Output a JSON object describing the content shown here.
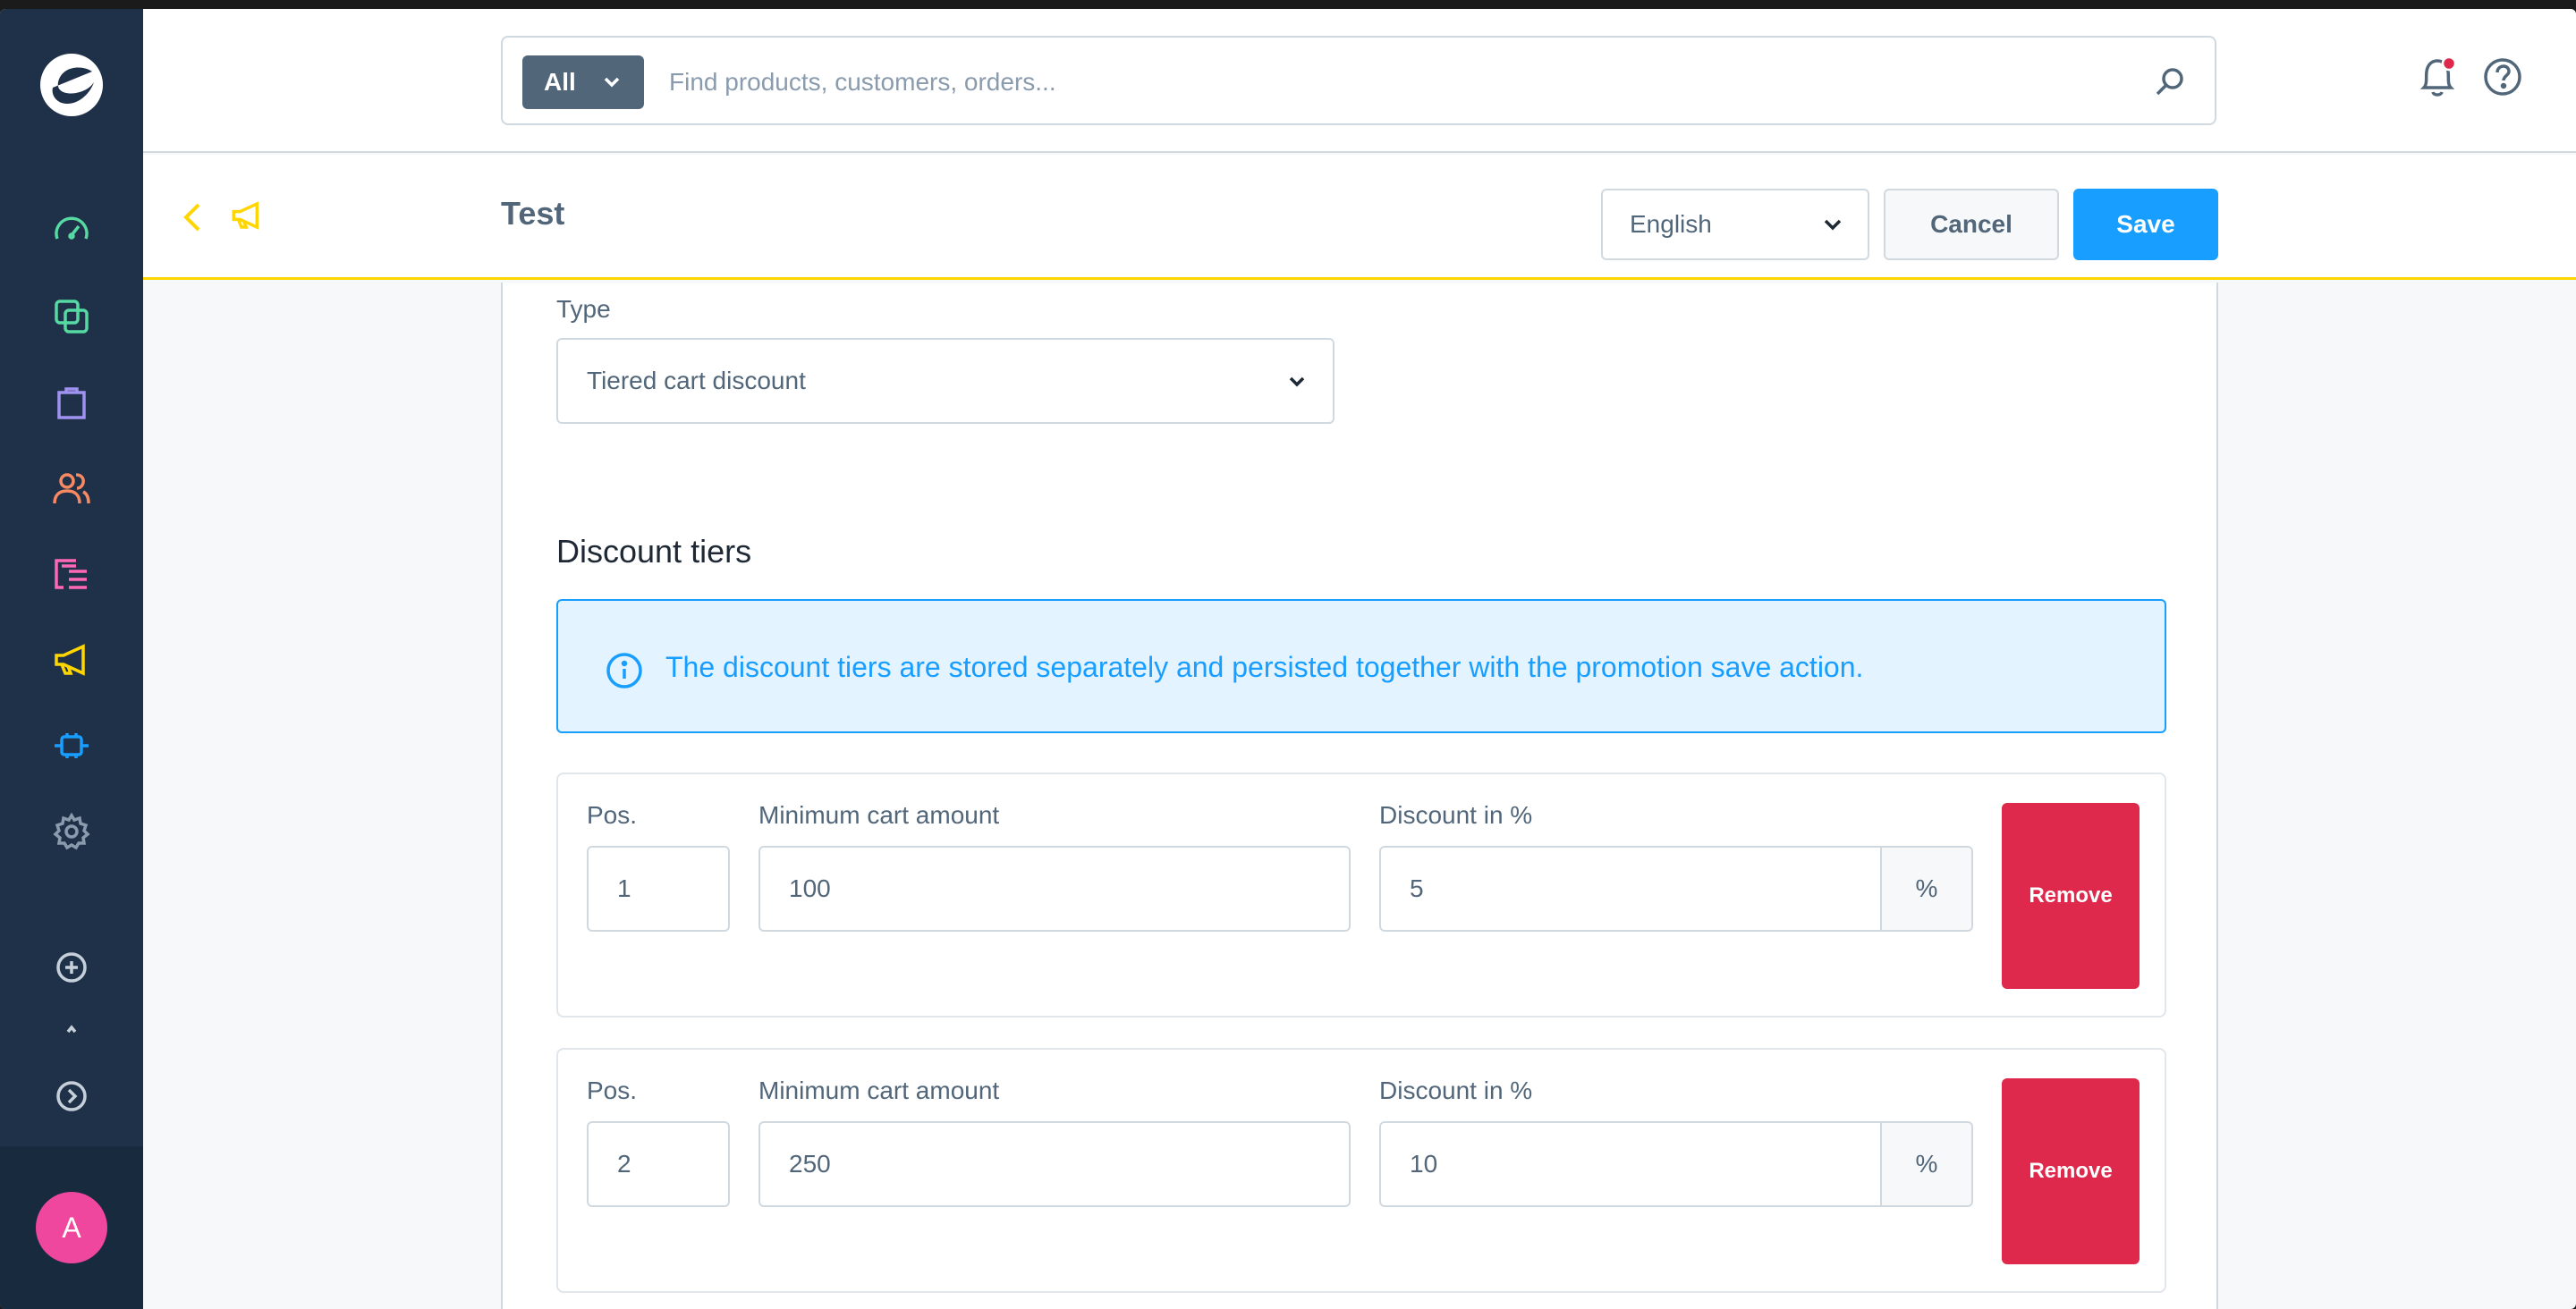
{
  "sidebar": {
    "nav": [
      {
        "name": "dashboard-icon",
        "color": "#57d9a3"
      },
      {
        "name": "catalog-icon",
        "color": "#57d9a3"
      },
      {
        "name": "orders-icon",
        "color": "#a092f0"
      },
      {
        "name": "customers-icon",
        "color": "#f88962"
      },
      {
        "name": "content-icon",
        "color": "#ff68b4"
      },
      {
        "name": "marketing-icon",
        "color": "#ffd600"
      },
      {
        "name": "extensions-icon",
        "color": "#189eff"
      },
      {
        "name": "settings-icon",
        "color": "#8a9bad"
      }
    ],
    "avatar_initial": "A"
  },
  "search": {
    "type_label": "All",
    "placeholder": "Find products, customers, orders..."
  },
  "smartbar": {
    "title": "Test",
    "language": "English",
    "cancel_label": "Cancel",
    "save_label": "Save"
  },
  "form": {
    "type_label": "Type",
    "type_value": "Tiered cart discount",
    "section_title": "Discount tiers",
    "info_text": "The discount tiers are stored separately and persisted together with the promotion save action.",
    "tiers": [
      {
        "pos_label": "Pos.",
        "pos": "1",
        "min_label": "Minimum cart amount",
        "min": "100",
        "discount_label": "Discount in %",
        "discount": "5",
        "suffix": "%",
        "remove_label": "Remove"
      },
      {
        "pos_label": "Pos.",
        "pos": "2",
        "min_label": "Minimum cart amount",
        "min": "250",
        "discount_label": "Discount in %",
        "discount": "10",
        "suffix": "%",
        "remove_label": "Remove"
      }
    ]
  },
  "colors": {
    "accent": "#189eff",
    "danger": "#de294c",
    "marketing": "#ffd600",
    "sidebar_bg": "#1e3148"
  }
}
